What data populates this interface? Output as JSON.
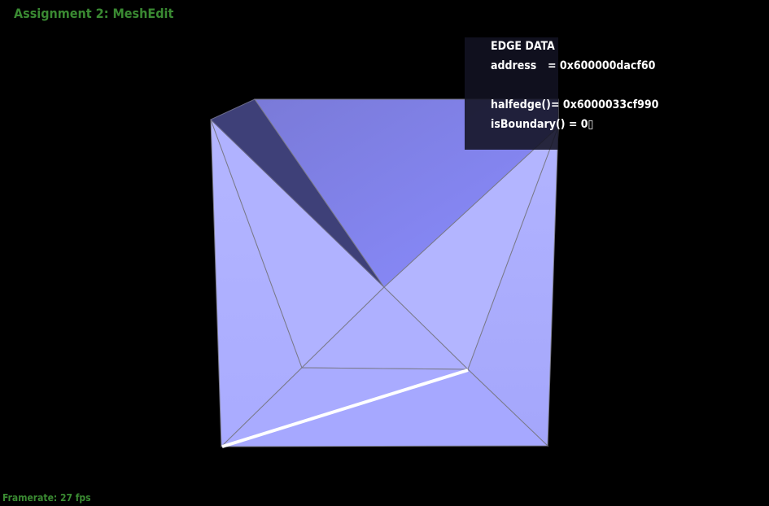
{
  "app": {
    "title": "Assignment 2: MeshEdit",
    "framerate": "Framerate: 27 fps"
  },
  "edge_panel": {
    "heading": "EDGE DATA",
    "rows": [
      {
        "key": "address",
        "value": "= 0x600000dacf60"
      },
      {
        "key": "halfedge()",
        "value": "= 0x6000033cf990"
      },
      {
        "key": "isBoundary()",
        "value": "= 0▯"
      }
    ]
  },
  "colors": {
    "title_green": "#3a8a32",
    "background": "#000000",
    "face_light": "#aaaaff",
    "face_highlight": "#8888f4",
    "face_dark": "#3d3f77",
    "edge_line": "#7a7a8a",
    "selected_edge": "#ffffff"
  }
}
